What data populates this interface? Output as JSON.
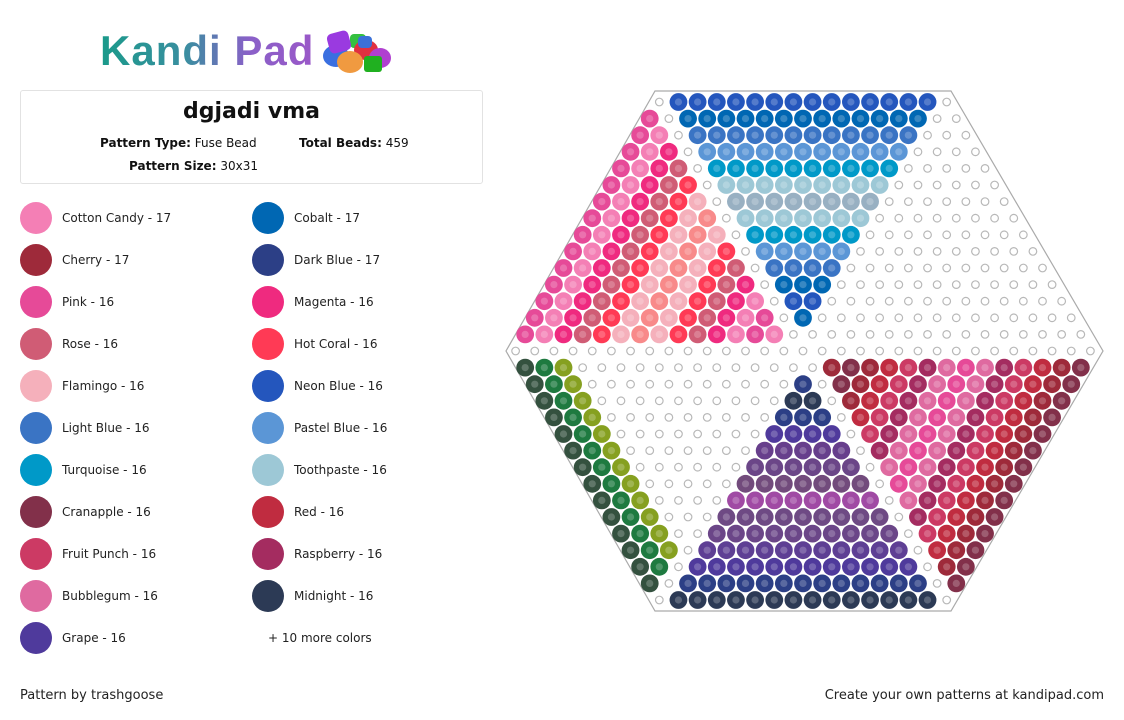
{
  "logo": {
    "text": "Kandi Pad"
  },
  "pattern": {
    "title": "dgjadi vma",
    "type_label": "Pattern Type:",
    "type_value": "Fuse Bead",
    "beads_label": "Total Beads:",
    "beads_value": "459",
    "size_label": "Pattern Size:",
    "size_value": "30x31"
  },
  "legend": {
    "col1": [
      {
        "label": "Cotton Candy - 17",
        "color": "#f47fb5"
      },
      {
        "label": "Cherry - 17",
        "color": "#9e2a3a"
      },
      {
        "label": "Pink - 16",
        "color": "#e64a98"
      },
      {
        "label": "Rose - 16",
        "color": "#d05c75"
      },
      {
        "label": "Flamingo - 16",
        "color": "#f5b0bb"
      },
      {
        "label": "Light Blue - 16",
        "color": "#3a74c4"
      },
      {
        "label": "Turquoise - 16",
        "color": "#0099c8"
      },
      {
        "label": "Cranapple - 16",
        "color": "#82304a"
      },
      {
        "label": "Fruit Punch - 16",
        "color": "#cc3a64"
      },
      {
        "label": "Bubblegum - 16",
        "color": "#df6aa0"
      },
      {
        "label": "Grape - 16",
        "color": "#4f3a9c"
      }
    ],
    "col2": [
      {
        "label": "Cobalt - 17",
        "color": "#0067b3"
      },
      {
        "label": "Dark Blue - 17",
        "color": "#2c3f86"
      },
      {
        "label": "Magenta - 16",
        "color": "#ef2a7f"
      },
      {
        "label": "Hot Coral - 16",
        "color": "#ff3a55"
      },
      {
        "label": "Neon Blue - 16",
        "color": "#2456bd"
      },
      {
        "label": "Pastel Blue - 16",
        "color": "#5b96d6"
      },
      {
        "label": "Toothpaste - 16",
        "color": "#9dc8d6"
      },
      {
        "label": "Red - 16",
        "color": "#c02c40"
      },
      {
        "label": "Raspberry - 16",
        "color": "#a42c60"
      },
      {
        "label": "Midnight - 16",
        "color": "#2c3a55"
      }
    ],
    "more": "+ 10 more colors"
  },
  "board": {
    "palette": {
      "N": "#2456bd",
      "C": "#0067b3",
      "L": "#3a74c4",
      "B": "#5b96d6",
      "T": "#0099c8",
      "W": "#9dc8d6",
      "G": "#98b0c2",
      "P": "#e64a98",
      "K": "#f47fb5",
      "M": "#ef2a7f",
      "R": "#d05c75",
      "H": "#ff3a55",
      "F": "#f5b0bb",
      "S": "#f88a8a",
      "D": "#34513f",
      "E": "#1e7a40",
      "O": "#86a020",
      "Y": "#9e2a3a",
      "A": "#82304a",
      "X": "#c02c40",
      "U": "#cc3a64",
      "Z": "#a42c60",
      "Q": "#df6aa0",
      "V": "#2c3f86",
      "J": "#2c3a55",
      "g": "#4f3a9c",
      "5": "#673f8c",
      "6": "#6b4688",
      "7": "#724b7c",
      "8": "#a04aa4",
      "9": "#6e4a84",
      "0": "#5e3f94"
    },
    "rows": [
      ".NNNNNNNNNNNNNN.",
      "P.CCCCCCCCCCCCC..",
      "PK.LLLLLLLLLLLL...",
      "PKM.BBBBBBBBBBB....",
      "PKMR.TTTTTTTTTT.....",
      "PKMRH.WWWWWWWWW......",
      "PKMRHF.GGGGGGGG.......",
      "PKMRHFS.WWWWWWW........",
      "PKMRHFSF.TTTTTT.........",
      "PKMRHFSFH.BBBBB..........",
      "PKMRHFSFHR.LLLL...........",
      "PKMRHFSFHRM.CCC............",
      "PKMRHFSFHRMK.NN.............",
      "PKMRHFSFHRMKP.C..............",
      "PKMRHFSFHRMKPK................",
      "...............................",
      "DEO.............YAYXUZQPQZUXYA",
      "DEO...........V.AYXUZQPQZUXYA",
      "DEO..........JJ.YXUZQPQZUXYA",
      "DEO.........VVV.XUZQPQZUXYA",
      "DEO........gggg.UZQPQZUXYA",
      "DEO.......55555.ZQPQZUXYA",
      "DEO......666666.QPQZUXYA",
      "DEO.....7777777.PQZUXYA",
      "DEO....88888888.QZUXYA",
      "DEO...999999999.ZUXYA",
      "DEO..6666666666.UXYA",
      "DEO.00000000000.XYA",
      "DE.gggggggggggg.YA",
      "D.VVVVVVVVVVVVV.A",
      ".JJJJJJJJJJJJJJ."
    ]
  },
  "footer": {
    "author": "Pattern by trashgoose",
    "cta": "Create your own patterns at kandipad.com"
  }
}
